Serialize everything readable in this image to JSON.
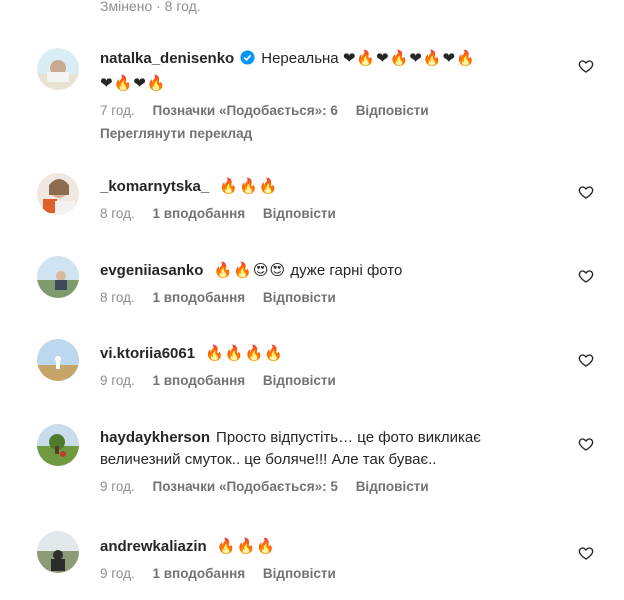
{
  "top": {
    "edited": "Змінено · 8 год."
  },
  "comments": [
    {
      "username": "natalka_denisenko",
      "verified": true,
      "text": "Нереальна",
      "emoji_line1": "❤🔥❤🔥❤🔥❤🔥",
      "emoji_line2": "❤🔥❤🔥",
      "time": "7 год.",
      "likes": "Позначки «Подобається»: 6",
      "reply": "Відповісти",
      "translate": "Переглянути переклад"
    },
    {
      "username": "_komarnytska_",
      "emoji": "🔥🔥🔥",
      "time": "8 год.",
      "likes": "1 вподобання",
      "reply": "Відповісти"
    },
    {
      "username": "evgeniiasanko",
      "emoji": "🔥🔥😍😍",
      "text": "дуже гарні фото",
      "time": "8 год.",
      "likes": "1 вподобання",
      "reply": "Відповісти"
    },
    {
      "username": "vi.ktoriia6061",
      "emoji": "🔥🔥🔥🔥",
      "time": "9 год.",
      "likes": "1 вподобання",
      "reply": "Відповісти"
    },
    {
      "username": "haydaykherson",
      "text_line1": "Просто відпустіть… це фото викликає",
      "text_line2": "величезний смуток.. це боляче!!! Але так буває..",
      "time": "9 год.",
      "likes": "Позначки «Подобається»: 5",
      "reply": "Відповісти"
    },
    {
      "username": "andrewkaliazin",
      "emoji": "🔥🔥🔥",
      "time": "9 год.",
      "likes": "1 вподобання",
      "reply": "Відповісти"
    }
  ],
  "icons": {
    "like": "heart-outline-icon",
    "verified": "verified-badge-icon"
  },
  "colors": {
    "text": "#262626",
    "muted": "#8e8e8e",
    "verified": "#0095f6"
  }
}
